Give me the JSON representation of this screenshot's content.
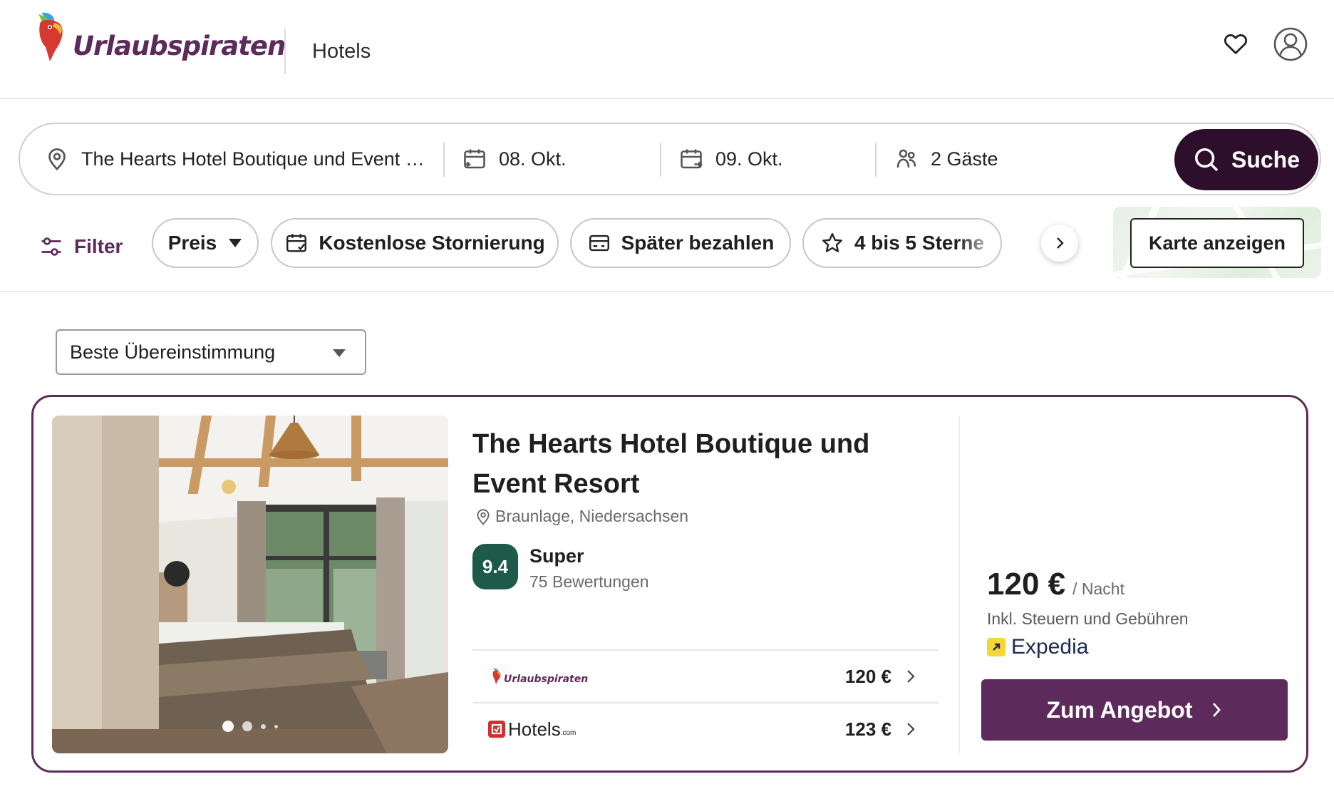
{
  "header": {
    "brand": "Urlaubspiraten",
    "section": "Hotels"
  },
  "search": {
    "destination": "The Hearts Hotel Boutique und Event …",
    "checkin": "08. Okt.",
    "checkout": "09. Okt.",
    "guests": "2 Gäste",
    "button_label": "Suche"
  },
  "filters": {
    "filter_label": "Filter",
    "chips": [
      "Preis",
      "Kostenlose Stornierung",
      "Später bezahlen",
      "4 bis 5 Sterne"
    ],
    "map_button": "Karte anzeigen"
  },
  "sort": {
    "selected": "Beste Übereinstimmung"
  },
  "hotel": {
    "name": "The Hearts Hotel Boutique und Event Resort",
    "location": "Braunlage, Niedersachsen",
    "score": "9.4",
    "score_label": "Super",
    "reviews": "75 Bewertungen",
    "photo_count": 4,
    "active_photo_index": 0,
    "offers": [
      {
        "provider": "Urlaubspiraten",
        "price": "120 €"
      },
      {
        "provider": "Hotels",
        "provider_suffix": ".com",
        "price": "123 €"
      }
    ],
    "best_price": "120 €",
    "per_night": "/ Nacht",
    "taxes_note": "Inkl. Steuern und Gebühren",
    "best_provider": "Expedia",
    "cta_label": "Zum Angebot"
  },
  "colors": {
    "brand_purple": "#5d2a5c",
    "search_button": "#2d0f2c",
    "score_badge": "#1e5a4a",
    "expedia_yellow": "#f6d633"
  }
}
